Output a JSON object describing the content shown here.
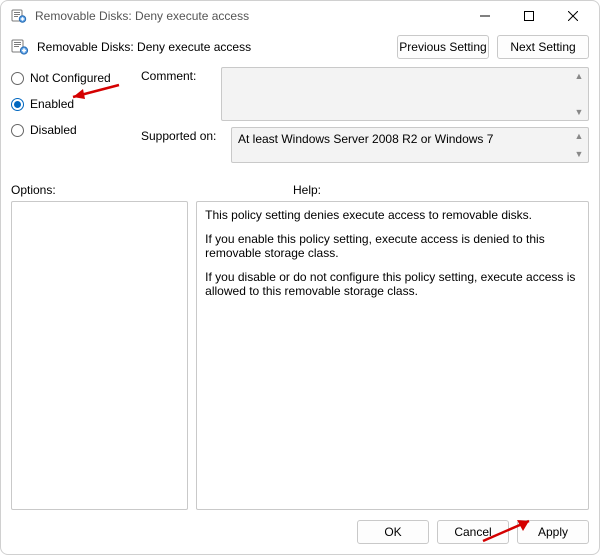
{
  "window": {
    "title": "Removable Disks: Deny execute access"
  },
  "header": {
    "policy_title": "Removable Disks: Deny execute access",
    "prev_label": "Previous Setting",
    "next_label": "Next Setting"
  },
  "state": {
    "not_configured_label": "Not Configured",
    "enabled_label": "Enabled",
    "disabled_label": "Disabled",
    "selected": "enabled"
  },
  "fields": {
    "comment_label": "Comment:",
    "comment_value": "",
    "supported_label": "Supported on:",
    "supported_value": "At least Windows Server 2008 R2 or Windows 7"
  },
  "panels": {
    "options_label": "Options:",
    "help_label": "Help:"
  },
  "help_text": {
    "p1": "This policy setting denies execute access to removable disks.",
    "p2": "If you enable this policy setting, execute access is denied to this removable storage class.",
    "p3": "If you disable or do not configure this policy setting, execute access is allowed to this removable storage class."
  },
  "buttons": {
    "ok": "OK",
    "cancel": "Cancel",
    "apply": "Apply"
  }
}
